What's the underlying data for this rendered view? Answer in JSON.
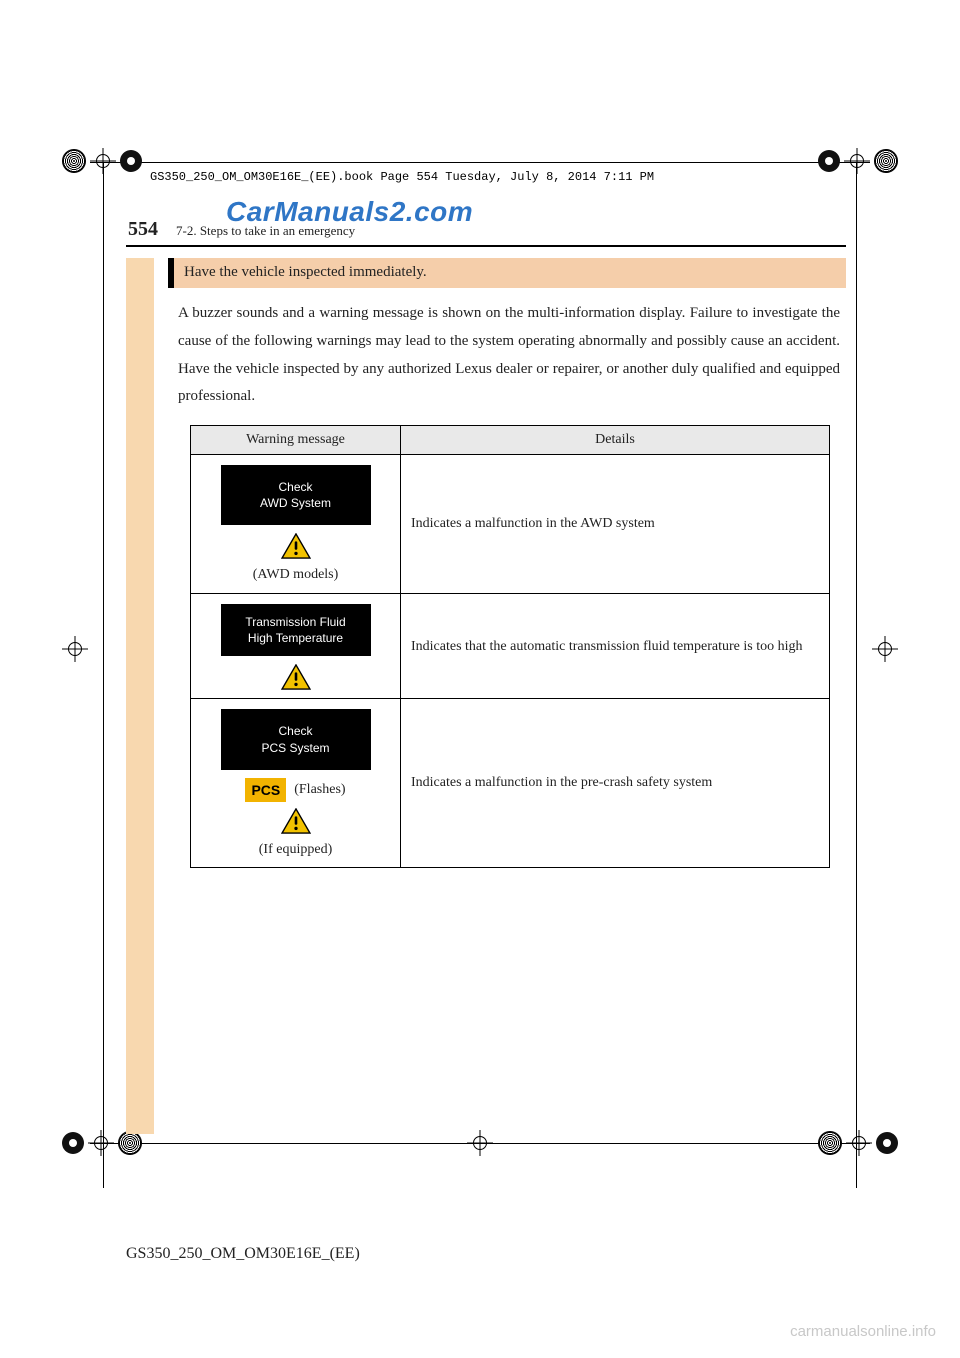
{
  "meta": {
    "book_header": "GS350_250_OM_OM30E16E_(EE).book  Page 554  Tuesday, July 8, 2014  7:11 PM",
    "watermark": "CarManuals2.com",
    "footer_code": "GS350_250_OM_OM30E16E_(EE)",
    "bottom_watermark": "carmanualsonline.info"
  },
  "header": {
    "page_number": "554",
    "section_path": "7-2. Steps to take in an emergency"
  },
  "heading": "Have the vehicle inspected immediately.",
  "paragraph": "A buzzer sounds and a warning message is shown on the multi-information display. Failure to investigate the cause of the following warnings may lead to the system operating abnormally and possibly cause an accident. Have the vehicle inspected by any authorized Lexus dealer or repairer, or another duly qualified and equipped professional.",
  "table": {
    "columns": {
      "msg": "Warning message",
      "det": "Details"
    },
    "rows": [
      {
        "display_line1": "Check",
        "display_line2": "AWD System",
        "note": "(AWD models)",
        "detail": "Indicates a malfunction in the AWD system"
      },
      {
        "display_line1": "Transmission Fluid",
        "display_line2": "High Temperature",
        "detail": "Indicates that the automatic transmission fluid temperature is too high"
      },
      {
        "display_line1": "Check",
        "display_line2": "PCS System",
        "pcs_label": "PCS",
        "pcs_flashes": "(Flashes)",
        "note": "(If equipped)",
        "detail": "Indicates a malfunction in the pre-crash safety system"
      }
    ]
  }
}
